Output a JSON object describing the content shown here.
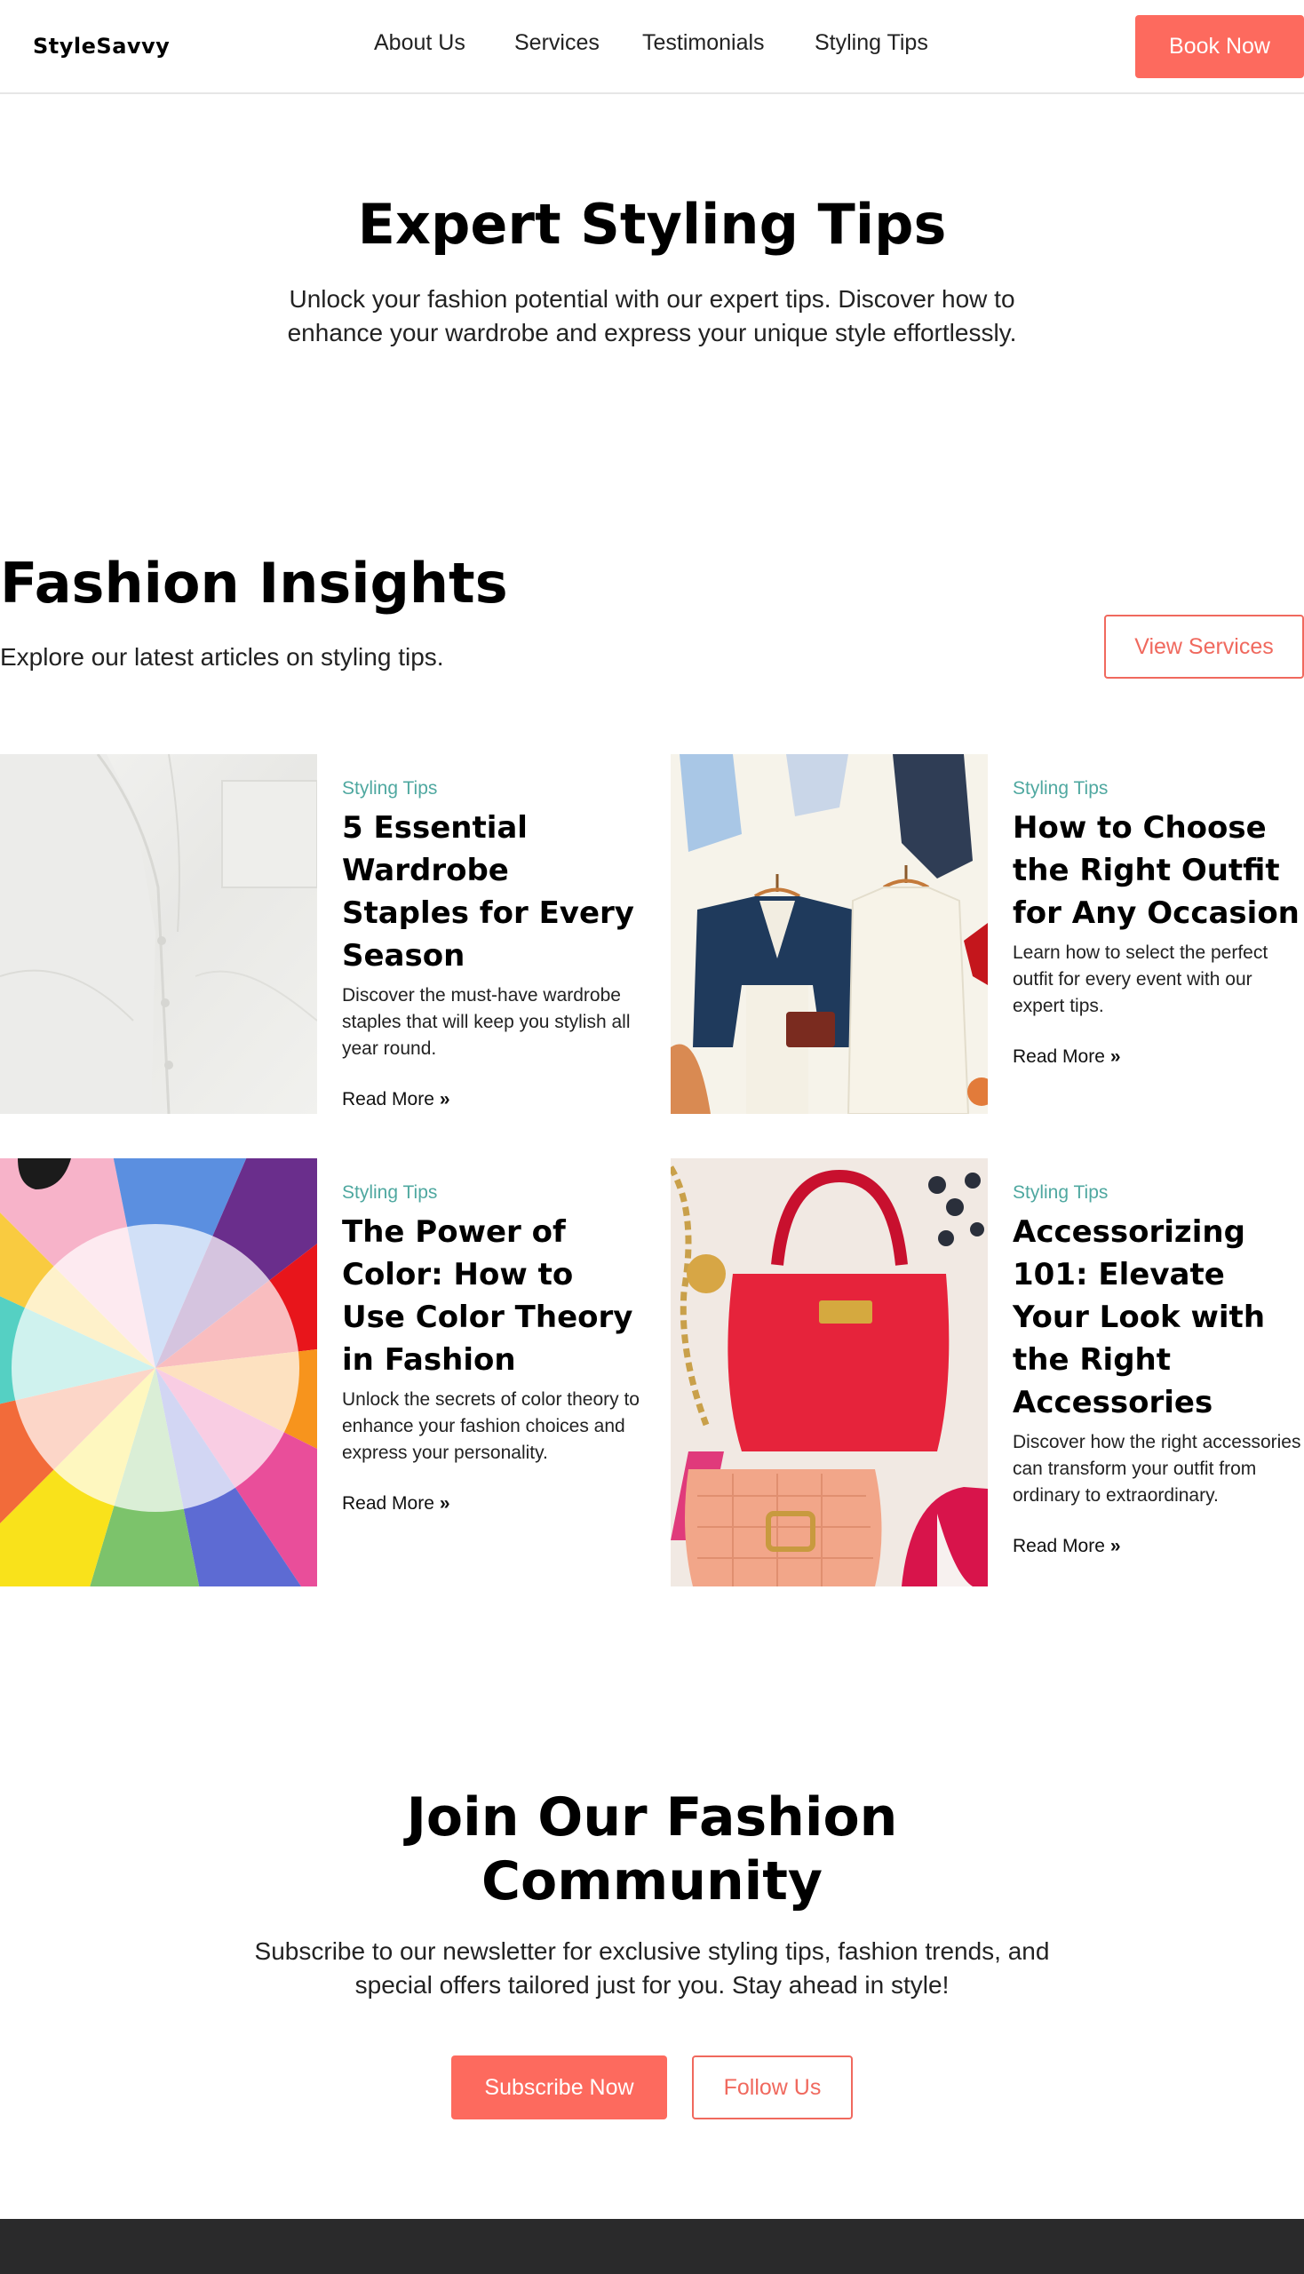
{
  "nav": {
    "logo": "StyleSavvy",
    "links": [
      "About Us",
      "Services",
      "Testimonials",
      "Styling Tips"
    ],
    "cta": "Book Now"
  },
  "hero": {
    "title": "Expert Styling Tips",
    "subtitle": "Unlock your fashion potential with our expert tips. Discover how to enhance your wardrobe and express your unique style effortlessly."
  },
  "insights": {
    "title": "Fashion Insights",
    "subtitle": "Explore our latest articles on styling tips.",
    "button": "View Services",
    "cards": [
      {
        "category": "Styling Tips",
        "title": "5 Essential Wardrobe Staples for Every Season",
        "description": "Discover the must-have wardrobe staples that will keep you stylish all year round.",
        "link": "Read More",
        "image": "white-shirt-photo"
      },
      {
        "category": "Styling Tips",
        "title": "How to Choose the Right Outfit for Any Occasion",
        "description": "Learn how to select the perfect outfit for every event with our expert tips.",
        "link": "Read More",
        "image": "outfits-on-hangers-photo"
      },
      {
        "category": "Styling Tips",
        "title": "The Power of Color: How to Use Color Theory in Fashion",
        "description": "Unlock the secrets of color theory to enhance your fashion choices and express your personality.",
        "link": "Read More",
        "image": "color-wheel-photo"
      },
      {
        "category": "Styling Tips",
        "title": "Accessorizing 101: Elevate Your Look with the Right Accessories",
        "description": "Discover how the right accessories can transform your outfit from ordinary to extraordinary.",
        "link": "Read More",
        "image": "handbag-accessories-photo"
      }
    ]
  },
  "join": {
    "title": "Join Our Fashion Community",
    "subtitle": "Subscribe to our newsletter for exclusive styling tips, fashion trends, and special offers tailored just for you. Stay ahead in style!",
    "primary": "Subscribe Now",
    "secondary": "Follow Us"
  },
  "colors": {
    "accent": "#fd6a5e",
    "category": "#4fa8a0",
    "footer": "#2a2a2b"
  }
}
